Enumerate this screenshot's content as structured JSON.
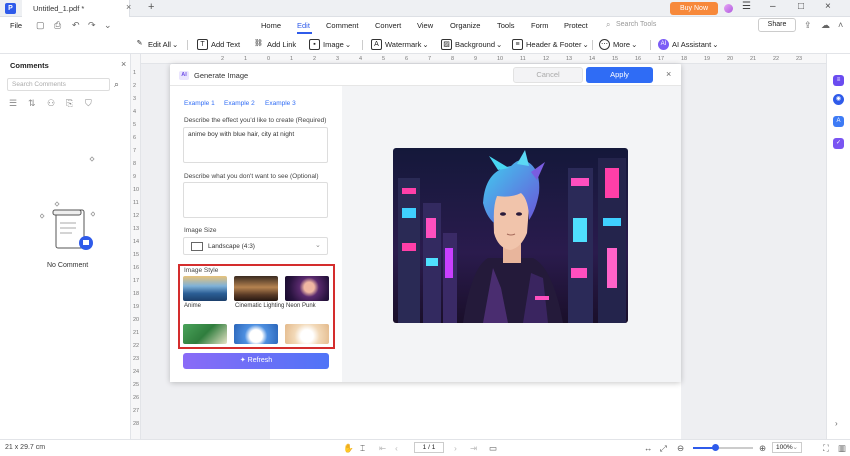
{
  "titlebar": {
    "doc_tab": "Untitled_1.pdf *",
    "buy_now": "Buy Now"
  },
  "menubar": {
    "file": "File",
    "tabs": [
      "Home",
      "Edit",
      "Comment",
      "Convert",
      "View",
      "Organize",
      "Tools",
      "Form",
      "Protect"
    ],
    "search_placeholder": "Search Tools",
    "share": "Share"
  },
  "toolbar": {
    "edit_all": "Edit All",
    "add_text": "Add Text",
    "add_link": "Add Link",
    "image": "Image",
    "watermark": "Watermark",
    "background": "Background",
    "header_footer": "Header & Footer",
    "more": "More",
    "ai_assistant": "AI Assistant"
  },
  "comments_panel": {
    "title": "Comments",
    "search_placeholder": "Search Comments",
    "empty_text": "No Comment"
  },
  "ruler": {
    "top": [
      "2",
      "1",
      "0",
      "1",
      "2",
      "3",
      "4",
      "5",
      "6",
      "7",
      "8",
      "9",
      "10",
      "11",
      "12",
      "13",
      "14",
      "15",
      "16",
      "17",
      "18",
      "19",
      "20",
      "21",
      "22",
      "23"
    ],
    "left": [
      "1",
      "2",
      "3",
      "4",
      "5",
      "6",
      "7",
      "8",
      "9",
      "10",
      "11",
      "12",
      "13",
      "14",
      "15",
      "16",
      "17",
      "18",
      "19",
      "20",
      "21",
      "22",
      "23",
      "24",
      "25",
      "26",
      "27",
      "28"
    ]
  },
  "dialog": {
    "ai_badge": "AI",
    "title": "Generate Image",
    "cancel": "Cancel",
    "apply": "Apply",
    "examples": [
      "Example 1",
      "Example 2",
      "Example 3"
    ],
    "prompt_label": "Describe the effect you'd like to create (Required)",
    "prompt_value": "anime boy with blue hair, city at night",
    "negative_label": "Describe what you don't want to see (Optional)",
    "negative_value": "",
    "size_label": "Image Size",
    "size_value": "Landscape (4:3)",
    "style_label": "Image Style",
    "styles": [
      "Anime",
      "Cinematic Lighting",
      "Neon Punk",
      "",
      "",
      ""
    ],
    "refresh": "Refresh"
  },
  "statusbar": {
    "page_size": "21 x 29.7 cm",
    "page_num": "1 / 1",
    "zoom": "100%",
    "zoom_fraction": 0.36
  },
  "colors": {
    "accent": "#2f5bea",
    "buy_now": "#f7893b",
    "highlight_frame": "#d42d2d"
  }
}
